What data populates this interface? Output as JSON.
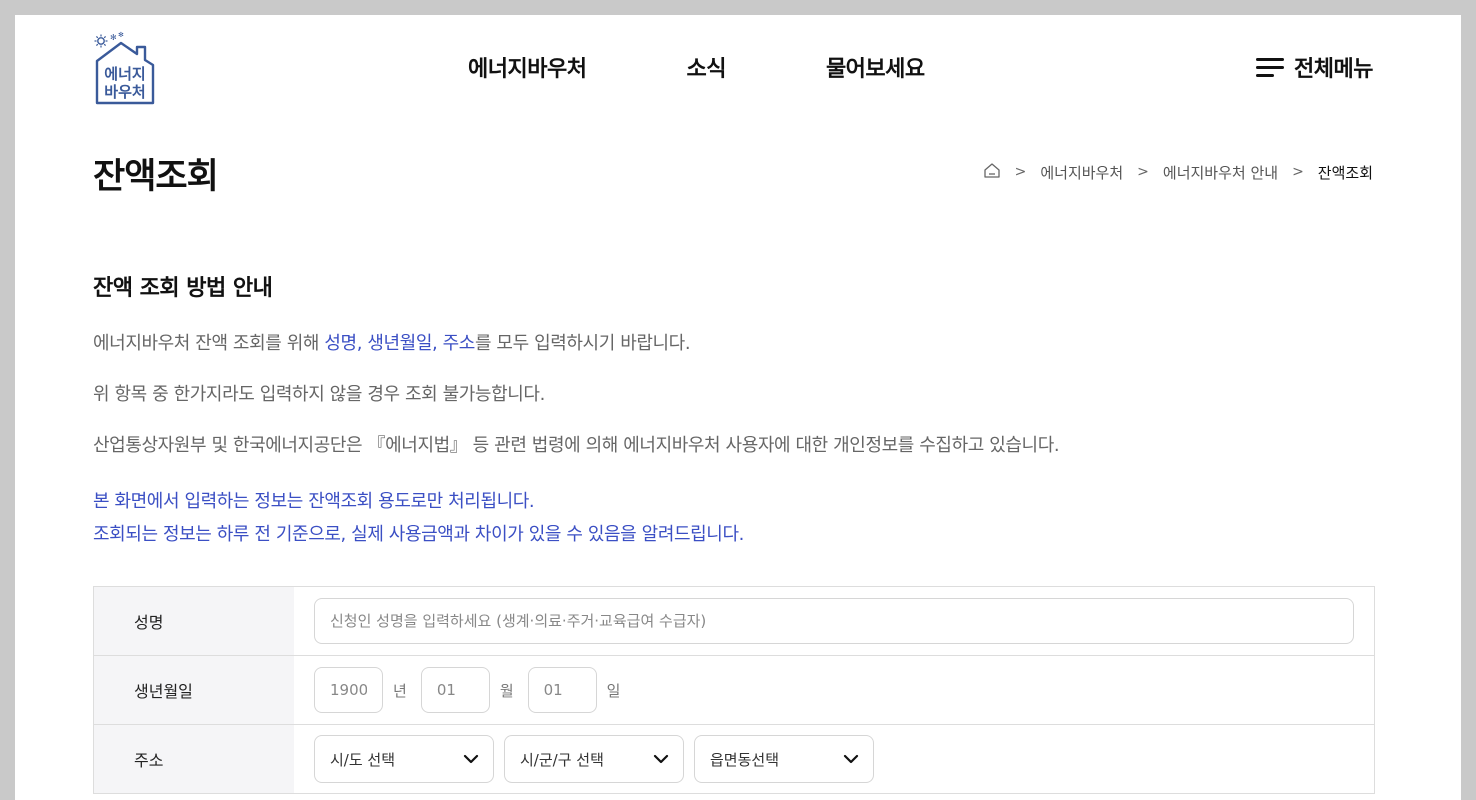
{
  "header": {
    "logo": {
      "line1": "에너지",
      "line2": "바우처"
    },
    "nav": [
      "에너지바우처",
      "소식",
      "물어보세요"
    ],
    "all_menu_label": "전체메뉴"
  },
  "page": {
    "title": "잔액조회",
    "breadcrumb": [
      "에너지바우처",
      "에너지바우처 안내",
      "잔액조회"
    ]
  },
  "guide": {
    "heading": "잔액 조회 방법 안내",
    "p1_before": "에너지바우처 잔액 조회를 위해 ",
    "p1_highlight": "성명, 생년월일, 주소",
    "p1_after": "를 모두 입력하시기 바랍니다.",
    "p2": "위 항목 중 한가지라도 입력하지 않을 경우 조회 불가능합니다.",
    "p3": "산업통상자원부 및 한국에너지공단은 『에너지법』 등 관련 법령에 의해 에너지바우처 사용자에 대한 개인정보를 수집하고 있습니다.",
    "notice1": "본 화면에서 입력하는 정보는 잔액조회 용도로만 처리됩니다.",
    "notice2": "조회되는 정보는 하루 전 기준으로, 실제 사용금액과 차이가 있을 수 있음을 알려드립니다."
  },
  "form": {
    "name": {
      "label": "성명",
      "placeholder": "신청인 성명을 입력하세요 (생계·의료·주거·교육급여 수급자)"
    },
    "birth": {
      "label": "생년월일",
      "year_value": "1900",
      "year_unit": "년",
      "month_value": "01",
      "month_unit": "월",
      "day_value": "01",
      "day_unit": "일"
    },
    "address": {
      "label": "주소",
      "sido": "시/도 선택",
      "sigungu": "시/군/구 선택",
      "eupmyeondong": "읍면동선택"
    }
  },
  "colors": {
    "accent": "#3b4fc4",
    "logo": "#3a5a9a"
  },
  "icons": [
    "logo-house-icon",
    "hamburger-icon",
    "home-icon",
    "chevron-right-icon",
    "chevron-down-icon"
  ]
}
